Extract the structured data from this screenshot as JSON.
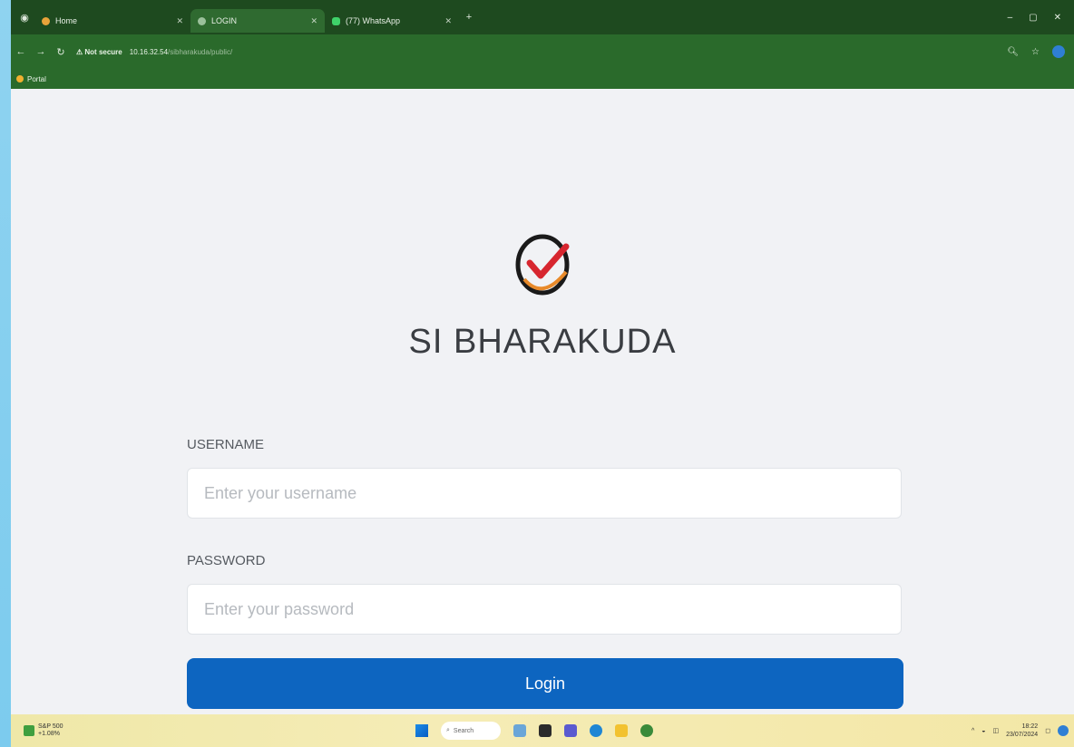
{
  "browser": {
    "tabs": [
      {
        "label": "Home",
        "active": false
      },
      {
        "label": "LOGIN",
        "active": true
      },
      {
        "label": "(77) WhatsApp",
        "active": false
      }
    ],
    "new_tab_symbol": "+",
    "window_controls": {
      "minimize": "–",
      "restore": "▢",
      "close": "✕"
    },
    "address": {
      "security_label": "⚠ Not secure",
      "host": "10.16.32.54",
      "path": "/sibharakuda/public/"
    },
    "bookmarks": [
      {
        "label": "Portal"
      }
    ]
  },
  "login": {
    "brand_name": "SI BHARAKUDA",
    "username_label": "USERNAME",
    "username_placeholder": "Enter your username",
    "username_value": "",
    "password_label": "PASSWORD",
    "password_placeholder": "Enter your password",
    "password_value": "",
    "login_button": "Login"
  },
  "taskbar": {
    "weather_line1": "S&P 500",
    "weather_line2": "+1.08%",
    "search_placeholder": "Search",
    "time": "18:22",
    "date": "23/07/2024"
  },
  "colors": {
    "chrome_dark": "#1e4a1f",
    "chrome_mid": "#2a6a2b",
    "primary_button": "#0d65c0",
    "page_bg": "#f1f2f5",
    "logo_red": "#d7262f",
    "logo_orange": "#e88a2a"
  }
}
